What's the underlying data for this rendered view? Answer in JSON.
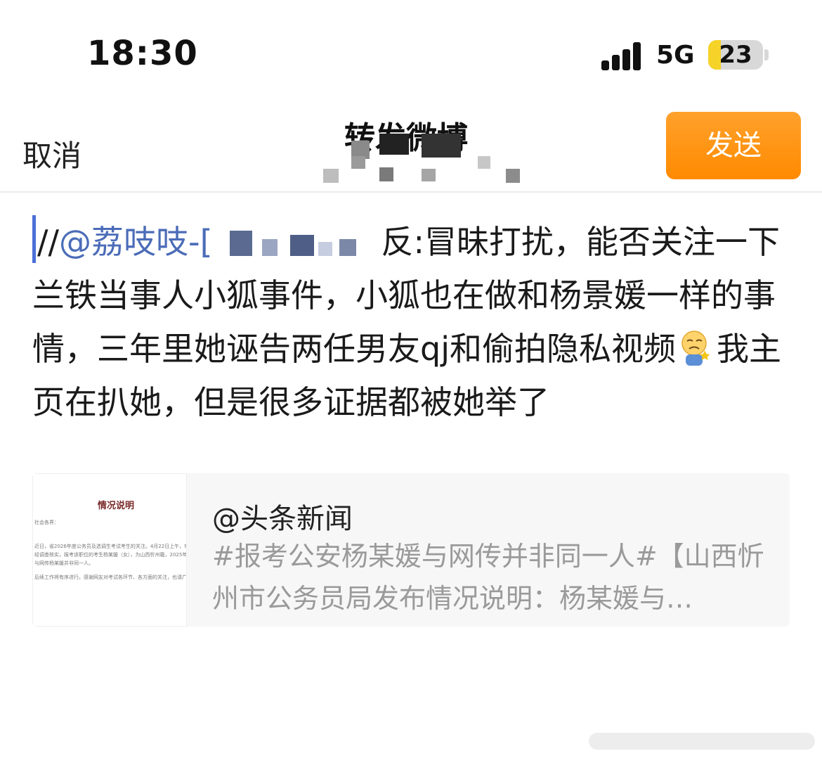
{
  "status_bar": {
    "time": "18:30",
    "network": "5G",
    "battery": "23",
    "battery_level": 0.23,
    "signal_icon": "cellular-signal-icon"
  },
  "nav": {
    "cancel_label": "取消",
    "title": "转发微博",
    "send_label": "发送"
  },
  "composer": {
    "prefix": "//",
    "mention": "@荔吱吱-[",
    "mention_end": "反",
    "body_1": ":冒昧打扰，能否关注一下兰铁当事人小狐事件，小狐也在做和杨景媛一样的事情，三年里她诬告两任男友qj和偷拍隐私视频",
    "emoji": "sad-face-emoji",
    "body_2": "我主页在扒她，但是很多证据都被她举了"
  },
  "quoted_card": {
    "thumbnail_title": "情况说明",
    "thumbnail_lines": [
      "社会各界：",
      "近日，省2026年度公务员及选调生考试考生的关注。4月22日上午，审核组",
      "经调查核实，报考该职位的考生杨某媛（女），为山西忻州籍，2025年7月本科",
      "与网传杨某媛并非同一人。",
      "后续工作将有序进行。感谢网友对考试各环节、各方面的关注，也请广大网友"
    ],
    "author": "@头条新闻",
    "text": "#报考公安杨某媛与网传并非同一人#【山西忻州市公务员局发布情况说明：杨某媛与…"
  },
  "colors": {
    "accent_orange": "#ff8a00",
    "mention_blue": "#4b6cb8",
    "muted_text": "#9a9a9a"
  }
}
